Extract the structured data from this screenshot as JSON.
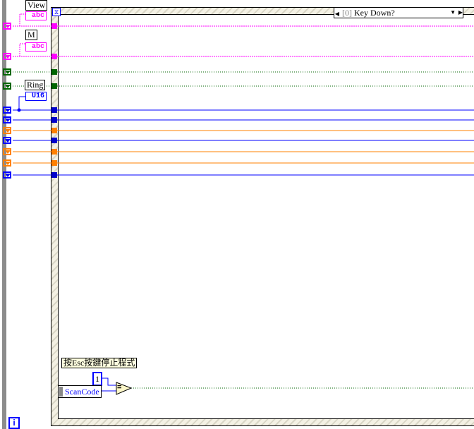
{
  "labels": {
    "view": "View",
    "m": "M",
    "ring": "Ring",
    "comment": "按Esc按鍵停止程式"
  },
  "constants": {
    "view_type": "abc",
    "m_type": "abc",
    "ring_type": "U16",
    "one": "1"
  },
  "event_selector": {
    "index": "[0]",
    "name": "Key Down?"
  },
  "event_data": {
    "scancode": "ScanCode"
  },
  "compare_op": "=",
  "iteration_terminal": "i",
  "colors": {
    "string": "#ff00ff",
    "bool": "#006600",
    "int": "#0000ff",
    "float": "#ff8000"
  }
}
